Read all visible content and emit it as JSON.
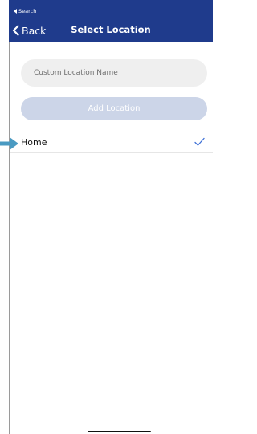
{
  "status_bar": {
    "back_app_label": "Search"
  },
  "nav": {
    "back_label": "Back",
    "title": "Select Location"
  },
  "form": {
    "location_name_placeholder": "Custom Location Name",
    "location_name_value": "",
    "add_button_label": "Add Location"
  },
  "locations": [
    {
      "label": "Home",
      "selected": true
    }
  ],
  "colors": {
    "nav_bg": "#1f3b8c",
    "disabled_button": "#ccd5e8",
    "checkmark": "#3d6fd6",
    "pointer_arrow": "#4a9ac2"
  },
  "icons": {
    "back": "chevron-left-icon",
    "status_back": "triangle-left-icon",
    "selected": "checkmark-icon",
    "pointer": "arrow-right-icon"
  }
}
